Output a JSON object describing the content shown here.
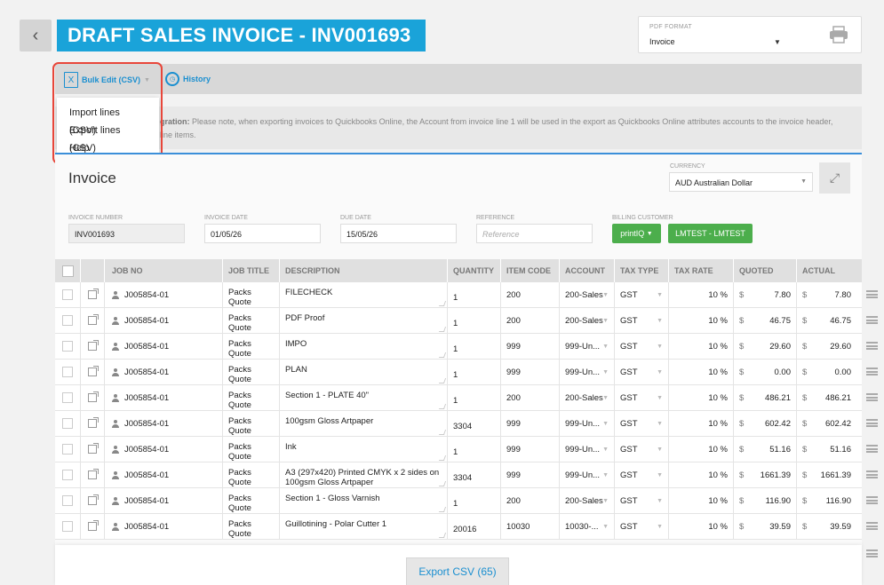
{
  "header": {
    "back_glyph": "‹",
    "title": "DRAFT SALES INVOICE - INV001693",
    "pdf_format": {
      "label": "PDF FORMAT",
      "value": "Invoice"
    }
  },
  "toolbar": {
    "bulk_edit_label": "Bulk Edit (CSV)",
    "history_label": "History"
  },
  "dropdown": {
    "items": [
      "Import lines (CSV)",
      "Export lines (CSV)",
      "Help"
    ]
  },
  "note": {
    "bold": "gration:",
    "text": " Please note, when exporting invoices to Quickbooks Online, the Account from invoice line 1 will be used in the export as Quickbooks Online attributes accounts to the invoice header,",
    "text2": "line items."
  },
  "invoice": {
    "heading": "Invoice",
    "currency": {
      "label": "CURRENCY",
      "value": "AUD Australian Dollar"
    },
    "fields": {
      "number": {
        "label": "INVOICE NUMBER",
        "value": "INV001693"
      },
      "date": {
        "label": "INVOICE DATE",
        "value": "01/05/26"
      },
      "due": {
        "label": "DUE DATE",
        "value": "15/05/26"
      },
      "reference": {
        "label": "REFERENCE",
        "placeholder": "Reference"
      },
      "customer": {
        "label": "BILLING CUSTOMER",
        "button": "printIQ",
        "contact": "LMTEST - LMTEST"
      }
    }
  },
  "table": {
    "columns": [
      "JOB NO",
      "JOB TITLE",
      "DESCRIPTION",
      "QUANTITY",
      "ITEM CODE",
      "ACCOUNT",
      "TAX TYPE",
      "TAX RATE",
      "QUOTED",
      "ACTUAL"
    ],
    "currency_symbol": "$",
    "rows": [
      {
        "job_no": "J005854-01",
        "job_title": "Packs Quote",
        "desc": "FILECHECK",
        "qty": "1",
        "item": "200",
        "account": "200-Sales",
        "tax": "GST",
        "rate": "10 %",
        "quoted": "7.80",
        "actual": "7.80"
      },
      {
        "job_no": "J005854-01",
        "job_title": "Packs Quote",
        "desc": "PDF Proof",
        "qty": "1",
        "item": "200",
        "account": "200-Sales",
        "tax": "GST",
        "rate": "10 %",
        "quoted": "46.75",
        "actual": "46.75"
      },
      {
        "job_no": "J005854-01",
        "job_title": "Packs Quote",
        "desc": "IMPO",
        "qty": "1",
        "item": "999",
        "account": "999-Un...",
        "tax": "GST",
        "rate": "10 %",
        "quoted": "29.60",
        "actual": "29.60"
      },
      {
        "job_no": "J005854-01",
        "job_title": "Packs Quote",
        "desc": "PLAN",
        "qty": "1",
        "item": "999",
        "account": "999-Un...",
        "tax": "GST",
        "rate": "10 %",
        "quoted": "0.00",
        "actual": "0.00"
      },
      {
        "job_no": "J005854-01",
        "job_title": "Packs Quote",
        "desc": "Section 1 - PLATE 40\"",
        "qty": "1",
        "item": "200",
        "account": "200-Sales",
        "tax": "GST",
        "rate": "10 %",
        "quoted": "486.21",
        "actual": "486.21"
      },
      {
        "job_no": "J005854-01",
        "job_title": "Packs Quote",
        "desc": "100gsm Gloss Artpaper",
        "qty": "3304",
        "item": "999",
        "account": "999-Un...",
        "tax": "GST",
        "rate": "10 %",
        "quoted": "602.42",
        "actual": "602.42"
      },
      {
        "job_no": "J005854-01",
        "job_title": "Packs Quote",
        "desc": "Ink",
        "qty": "1",
        "item": "999",
        "account": "999-Un...",
        "tax": "GST",
        "rate": "10 %",
        "quoted": "51.16",
        "actual": "51.16"
      },
      {
        "job_no": "J005854-01",
        "job_title": "Packs Quote",
        "desc": "A3 (297x420) Printed CMYK x 2 sides on 100gsm Gloss Artpaper",
        "qty": "3304",
        "item": "999",
        "account": "999-Un...",
        "tax": "GST",
        "rate": "10 %",
        "quoted": "1661.39",
        "actual": "1661.39"
      },
      {
        "job_no": "J005854-01",
        "job_title": "Packs Quote",
        "desc": "Section 1 - Gloss Varnish",
        "qty": "1",
        "item": "200",
        "account": "200-Sales",
        "tax": "GST",
        "rate": "10 %",
        "quoted": "116.90",
        "actual": "116.90"
      },
      {
        "job_no": "J005854-01",
        "job_title": "Packs Quote",
        "desc": "Guillotining - Polar Cutter 1",
        "qty": "20016",
        "item": "10030",
        "account": "10030-...",
        "tax": "GST",
        "rate": "10 %",
        "quoted": "39.59",
        "actual": "39.59"
      }
    ]
  },
  "footer": {
    "export_label": "Export CSV (65)"
  }
}
